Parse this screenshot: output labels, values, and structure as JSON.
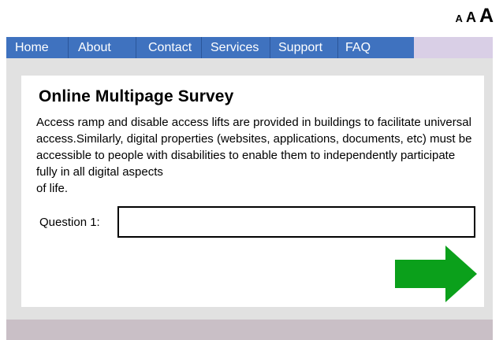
{
  "font_size_controls": {
    "small": "A",
    "medium": "A",
    "large": "A"
  },
  "nav": {
    "items": [
      {
        "label": "Home"
      },
      {
        "label": "About"
      },
      {
        "label": "Contact"
      },
      {
        "label": "Services"
      },
      {
        "label": "Support"
      },
      {
        "label": "FAQ"
      }
    ]
  },
  "survey": {
    "title": "Online Multipage Survey",
    "description": "Access ramp and disable access lifts are provided in buildings to facilitate universal access.Similarly, digital properties (websites, applications, documents, etc) must be accessible to people with disabilities to enable them to independently participate fully in all digital aspects\nof life.",
    "question_label": "Question 1:",
    "question_value": "",
    "next_icon": "right-arrow-icon"
  },
  "colors": {
    "nav_blue": "#3f72bf",
    "nav_spacer": "#d9cfe6",
    "grey_band": "#e1e1e1",
    "footer_bar": "#c9bfc6",
    "arrow_green": "#0ba01b"
  }
}
